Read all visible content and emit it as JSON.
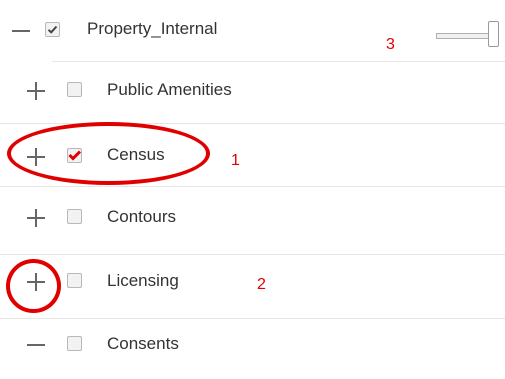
{
  "layers": [
    {
      "name": "Property_Internal",
      "toggle": "minus",
      "checked": true,
      "check_style": "dark"
    },
    {
      "name": "Public Amenities",
      "toggle": "plus",
      "checked": false
    },
    {
      "name": "Census",
      "toggle": "plus",
      "checked": true,
      "check_style": "red"
    },
    {
      "name": "Contours",
      "toggle": "plus",
      "checked": false
    },
    {
      "name": "Licensing",
      "toggle": "plus",
      "checked": false
    },
    {
      "name": "Consents",
      "toggle": "minus",
      "checked": false
    }
  ],
  "opacity_slider": {
    "value_fraction": 1.0
  },
  "annotations": {
    "marker_1": "1",
    "marker_2": "2",
    "marker_3": "3"
  },
  "colors": {
    "annotation": "#e00000",
    "divider": "#e6e6e6",
    "text": "#333333"
  }
}
